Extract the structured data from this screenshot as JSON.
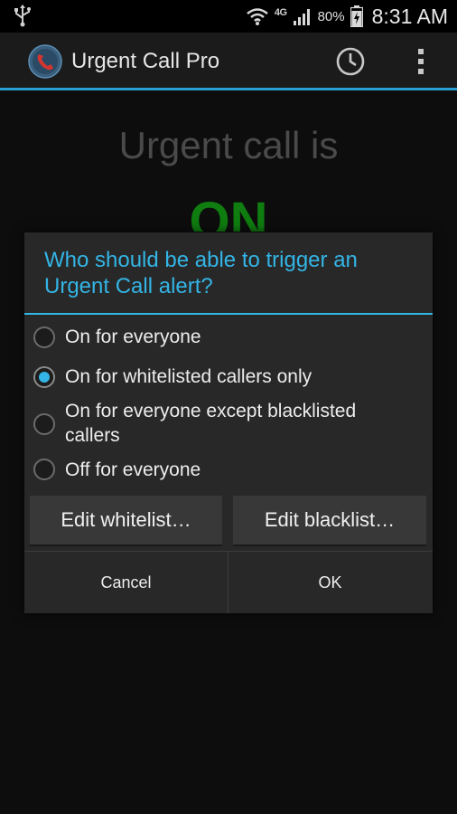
{
  "status_bar": {
    "network_type": "4G",
    "battery_percent": "80%",
    "time": "8:31 AM"
  },
  "action_bar": {
    "title": "Urgent Call Pro",
    "icons": [
      "phone-icon",
      "history-icon",
      "overflow-menu-icon"
    ]
  },
  "main": {
    "heading": "Urgent call is",
    "status": "ON",
    "status_color": "#0f7d10"
  },
  "dialog": {
    "title": "Who should be able to trigger an Urgent Call alert?",
    "options": [
      {
        "label": "On for everyone",
        "checked": false
      },
      {
        "label": "On for whitelisted callers only",
        "checked": true
      },
      {
        "label": "On for everyone except blacklisted callers",
        "checked": false
      },
      {
        "label": "Off for everyone",
        "checked": false
      }
    ],
    "edit_whitelist_label": "Edit whitelist…",
    "edit_blacklist_label": "Edit blacklist…",
    "cancel_label": "Cancel",
    "ok_label": "OK"
  },
  "colors": {
    "accent": "#33b5e5",
    "on_green": "#0f7d10"
  }
}
